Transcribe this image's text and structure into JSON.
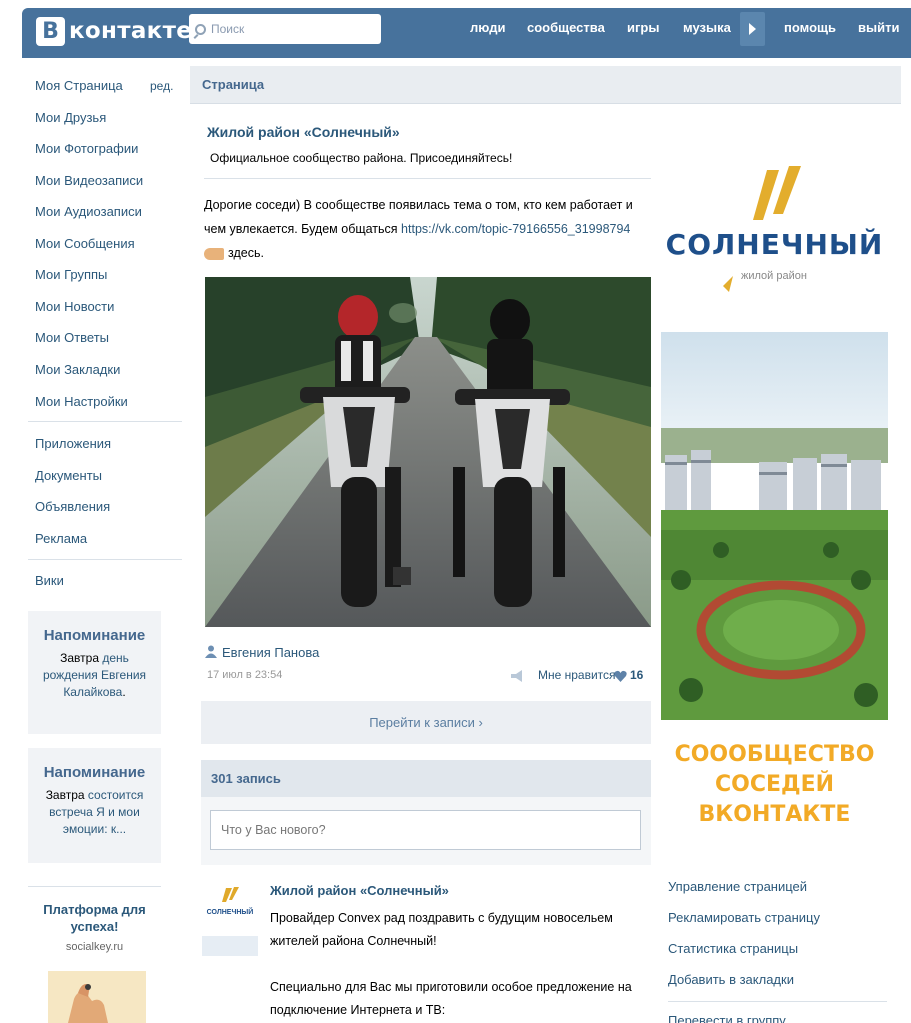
{
  "header": {
    "logo_letter": "В",
    "logo_text": "контакте",
    "search_placeholder": "Поиск",
    "nav": [
      "люди",
      "сообщества",
      "игры",
      "музыка",
      "помощь",
      "выйти"
    ]
  },
  "sidebar": {
    "edit_label": "ред.",
    "items": [
      "Моя Страница",
      "Мои Друзья",
      "Мои Фотографии",
      "Мои Видеозаписи",
      "Мои Аудиозаписи",
      "Мои Сообщения",
      "Мои Группы",
      "Мои Новости",
      "Мои Ответы",
      "Мои Закладки",
      "Мои Настройки"
    ],
    "items2": [
      "Приложения",
      "Документы",
      "Объявления",
      "Реклама"
    ],
    "items3": [
      "Вики"
    ],
    "reminder1": {
      "title": "Напоминание",
      "t1": "Завтра ",
      "t2": "день рождения",
      "t3": " ",
      "t4": "Евгения Калайкова",
      "t5": "."
    },
    "reminder2": {
      "title": "Напоминание",
      "t1": "Завтра ",
      "t2": "состоится встреча",
      "t3": " ",
      "t4": "Я и мои эмоции: к...",
      "t5": ""
    },
    "promo": {
      "title": "Платформа для успеха!",
      "domain": "socialkey.ru"
    }
  },
  "main": {
    "section_title": "Страница",
    "group_name": "Жилой район «Солнечный»",
    "group_status": "Официальное сообщество района. Присоединяйтесь!",
    "post": {
      "text": "Дорогие соседи) В сообществе появилась тема о том, кто кем работает и чем увлекается. Будем общаться ",
      "link": "https://vk.com/topic-79166556_31998794",
      "after_link": "здесь.",
      "author": "Евгения Панова",
      "date": "17 июл в 23:54",
      "like_label": "Мне нравится",
      "like_count": "16",
      "goto_label": "Перейти к записи ›"
    },
    "wall": {
      "count_label": "301 запись",
      "input_placeholder": "Что у Вас нового?"
    },
    "post2": {
      "author": "Жилой район «Солнечный»",
      "avatar_text": "СОЛНЕЧНЫЙ",
      "lines": [
        "Провайдер Convex рад поздравить с будущим новосельем жителей района Солнечный!",
        "",
        "Специально для Вас мы приготовили особое предложение на подключение Интернета и ТВ:"
      ]
    }
  },
  "right": {
    "ad_title": "СОЛНЕЧНЫЙ",
    "ad_sub": "жилой район",
    "ad_cta": [
      "СОООБЩЕСТВО",
      "СОСЕДЕЙ",
      "ВКОНТАКТЕ"
    ],
    "links": [
      "Управление страницей",
      "Рекламировать страницу",
      "Статистика страницы",
      "Добавить в закладки",
      "Перевести в группу"
    ]
  }
}
